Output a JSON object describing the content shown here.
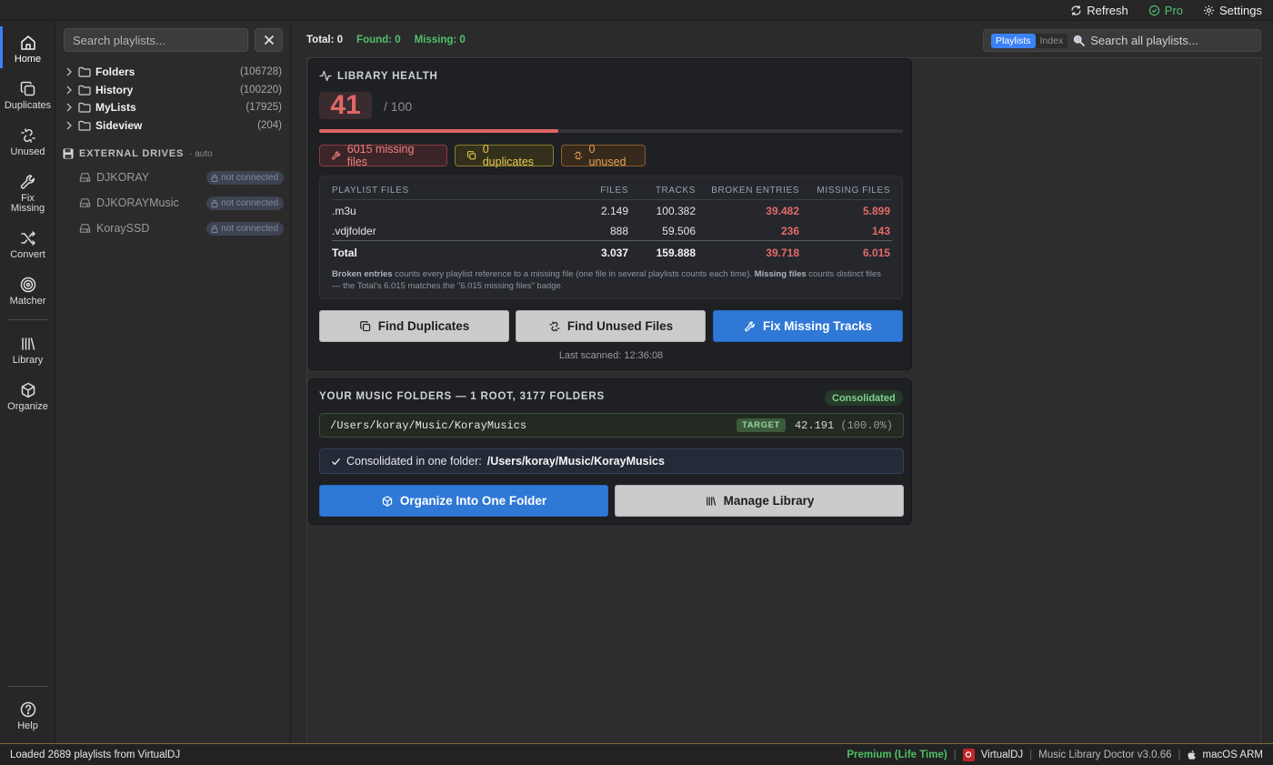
{
  "topbar": {
    "refresh_label": "Refresh",
    "pro_label": "Pro",
    "settings_label": "Settings"
  },
  "nav": {
    "items": [
      {
        "label": "Home",
        "icon": "home-icon"
      },
      {
        "label": "Duplicates",
        "icon": "duplicates-icon"
      },
      {
        "label": "Unused",
        "icon": "unlink-icon"
      },
      {
        "label": "Fix Missing",
        "icon": "wrench-icon"
      },
      {
        "label": "Convert",
        "icon": "shuffle-icon"
      },
      {
        "label": "Matcher",
        "icon": "target-icon"
      },
      {
        "label": "Library",
        "icon": "library-icon"
      },
      {
        "label": "Organize",
        "icon": "package-icon"
      }
    ],
    "help_label": "Help"
  },
  "sidebar": {
    "search_placeholder": "Search playlists...",
    "tree": [
      {
        "name": "Folders",
        "count": "(106728)"
      },
      {
        "name": "History",
        "count": "(100220)"
      },
      {
        "name": "MyLists",
        "count": "(17925)"
      },
      {
        "name": "Sideview",
        "count": "(204)"
      }
    ],
    "drives_title": "EXTERNAL DRIVES",
    "drives_mode": "· auto",
    "drives": [
      {
        "name": "DJKORAY",
        "status": "not connected"
      },
      {
        "name": "DJKORAYMusic",
        "status": "not connected"
      },
      {
        "name": "KoraySSD",
        "status": "not connected"
      }
    ]
  },
  "main": {
    "total": "Total: 0",
    "found": "Found: 0",
    "missing": "Missing: 0",
    "search_tab_playlists": "Playlists",
    "search_tab_index": "Index",
    "search_placeholder": "Search all playlists..."
  },
  "health": {
    "title": "LIBRARY HEALTH",
    "score": "41",
    "score_max": "/ 100",
    "score_fraction": 0.41,
    "missing_badge": "6015 missing files",
    "duplicates_badge": "0 duplicates",
    "unused_badge": "0 unused",
    "table": {
      "headers": [
        "PLAYLIST FILES",
        "FILES",
        "TRACKS",
        "BROKEN ENTRIES",
        "MISSING FILES"
      ],
      "rows": [
        [
          ".m3u",
          "2.149",
          "100.382",
          "39.482",
          "5.899"
        ],
        [
          ".vdjfolder",
          "888",
          "59.506",
          "236",
          "143"
        ]
      ],
      "total": [
        "Total",
        "3.037",
        "159.888",
        "39.718",
        "6.015"
      ]
    },
    "note_b1": "Broken entries",
    "note_t1": " counts every playlist reference to a missing file (one file in several playlists counts each time). ",
    "note_b2": "Missing files",
    "note_t2": " counts distinct files — the Total's 6.015 matches the \"6.015 missing files\" badge.",
    "btn_duplicates": "Find Duplicates",
    "btn_unused": "Find Unused Files",
    "btn_fix": "Fix Missing Tracks",
    "last_scanned": "Last scanned: 12:36:08"
  },
  "folders": {
    "title": "YOUR MUSIC FOLDERS — 1 ROOT, 3177 FOLDERS",
    "status_badge": "Consolidated",
    "path": "/Users/koray/Music/KorayMusics",
    "target_badge": "TARGET",
    "path_count": "42.191",
    "path_pct": "(100.0%)",
    "consolidated_prefix": "Consolidated in one folder:",
    "consolidated_path": "/Users/koray/Music/KorayMusics",
    "btn_organize": "Organize Into One Folder",
    "btn_manage": "Manage Library"
  },
  "statusbar": {
    "message": "Loaded 2689 playlists from VirtualDJ",
    "license": "Premium (Life Time)",
    "app_source": "VirtualDJ",
    "version": "Music Library Doctor v3.0.66",
    "platform": "macOS ARM",
    "separator": "|"
  },
  "colors": {
    "accent": "#3b82f6",
    "danger": "#e06464",
    "success": "#52c06a",
    "warning": "#e8c84c"
  }
}
